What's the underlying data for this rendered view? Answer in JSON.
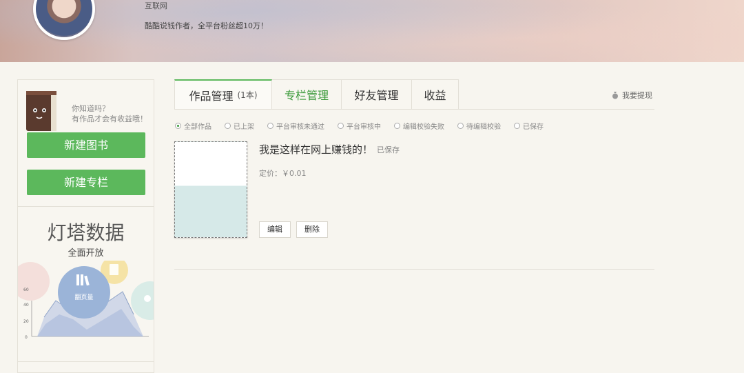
{
  "header": {
    "subtitle": "互联网",
    "description": "酷酷说钱作者，全平台粉丝超10万！"
  },
  "sidebar": {
    "tip_line1": "你知道吗？",
    "tip_line2": "有作品才会有收益哦！",
    "new_book_label": "新建图书",
    "new_column_label": "新建专栏",
    "promo_title": "灯塔数据",
    "promo_subtitle": "全面开放",
    "promo_badge": "翻页量",
    "promo_axis": [
      "0",
      "20",
      "40",
      "60"
    ]
  },
  "tabs": [
    {
      "label": "作品管理",
      "count": "(1本)"
    },
    {
      "label": "专栏管理"
    },
    {
      "label": "好友管理"
    },
    {
      "label": "收益"
    }
  ],
  "withdraw_label": "我要提现",
  "filters": [
    "全部作品",
    "已上架",
    "平台审核未通过",
    "平台审核中",
    "编辑校验失败",
    "待编辑校验",
    "已保存"
  ],
  "work": {
    "title": "我是这样在网上赚钱的！",
    "status": "已保存",
    "price": "定价：￥0.01",
    "edit_label": "编辑",
    "delete_label": "删除"
  },
  "colors": {
    "accent_green": "#5cb85c",
    "tab_active_text": "#3a9a3a"
  }
}
